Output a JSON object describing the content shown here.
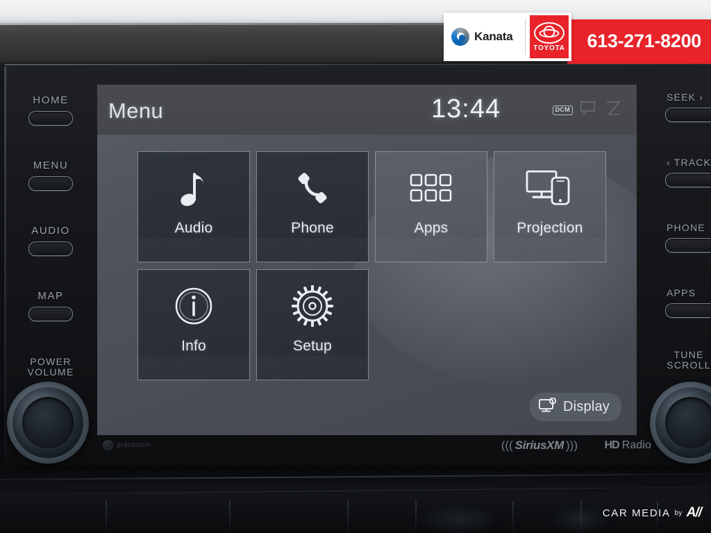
{
  "banner": {
    "phone": "613-271-8200",
    "dealer_name": "Kanata",
    "brand": "TOYOTA",
    "accent_color": "#e8232a",
    "logo_icon": "kanata-swirl-logo",
    "brand_icon": "toyota-oval-logo"
  },
  "head_unit": {
    "screen": {
      "header": {
        "title": "Menu",
        "clock": "13:44",
        "status_icons": [
          {
            "name": "dcm-badge",
            "label": "DCM"
          },
          {
            "name": "traffic-icon",
            "label": ""
          },
          {
            "name": "signal-icon",
            "label": ""
          }
        ]
      },
      "tiles": [
        {
          "label": "Audio",
          "icon": "music-note-icon",
          "state": "dark"
        },
        {
          "label": "Phone",
          "icon": "phone-handset-icon",
          "state": "dark"
        },
        {
          "label": "Apps",
          "icon": "app-grid-icon",
          "state": "lit"
        },
        {
          "label": "Projection",
          "icon": "monitor-phone-icon",
          "state": "lit"
        },
        {
          "label": "Info",
          "icon": "info-circle-icon",
          "state": "dark"
        },
        {
          "label": "Setup",
          "icon": "gear-icon",
          "state": "dark"
        }
      ],
      "display_button": {
        "label": "Display",
        "icon": "display-settings-icon"
      }
    },
    "left_keys": [
      {
        "label": "HOME"
      },
      {
        "label": "MENU"
      },
      {
        "label": "AUDIO"
      },
      {
        "label": "MAP"
      }
    ],
    "left_knob": {
      "line1": "POWER",
      "line2": "VOLUME"
    },
    "right_keys": [
      {
        "label": "SEEK ›"
      },
      {
        "label": "‹ TRACK"
      },
      {
        "label": "PHONE"
      },
      {
        "label": "APPS"
      }
    ],
    "right_knob": {
      "line1": "TUNE",
      "line2": "SCROLL"
    },
    "brands": [
      {
        "name": "gracenote",
        "label": "gracenote"
      },
      {
        "name": "siriusxm",
        "label": "SiriusXM",
        "wave_left": "(((",
        "wave_right": ")))"
      },
      {
        "name": "hd-radio",
        "mark": "HD",
        "label": "Radio"
      }
    ]
  },
  "watermark": {
    "text": "CAR MEDIA",
    "by": "by",
    "mark": "A//"
  }
}
